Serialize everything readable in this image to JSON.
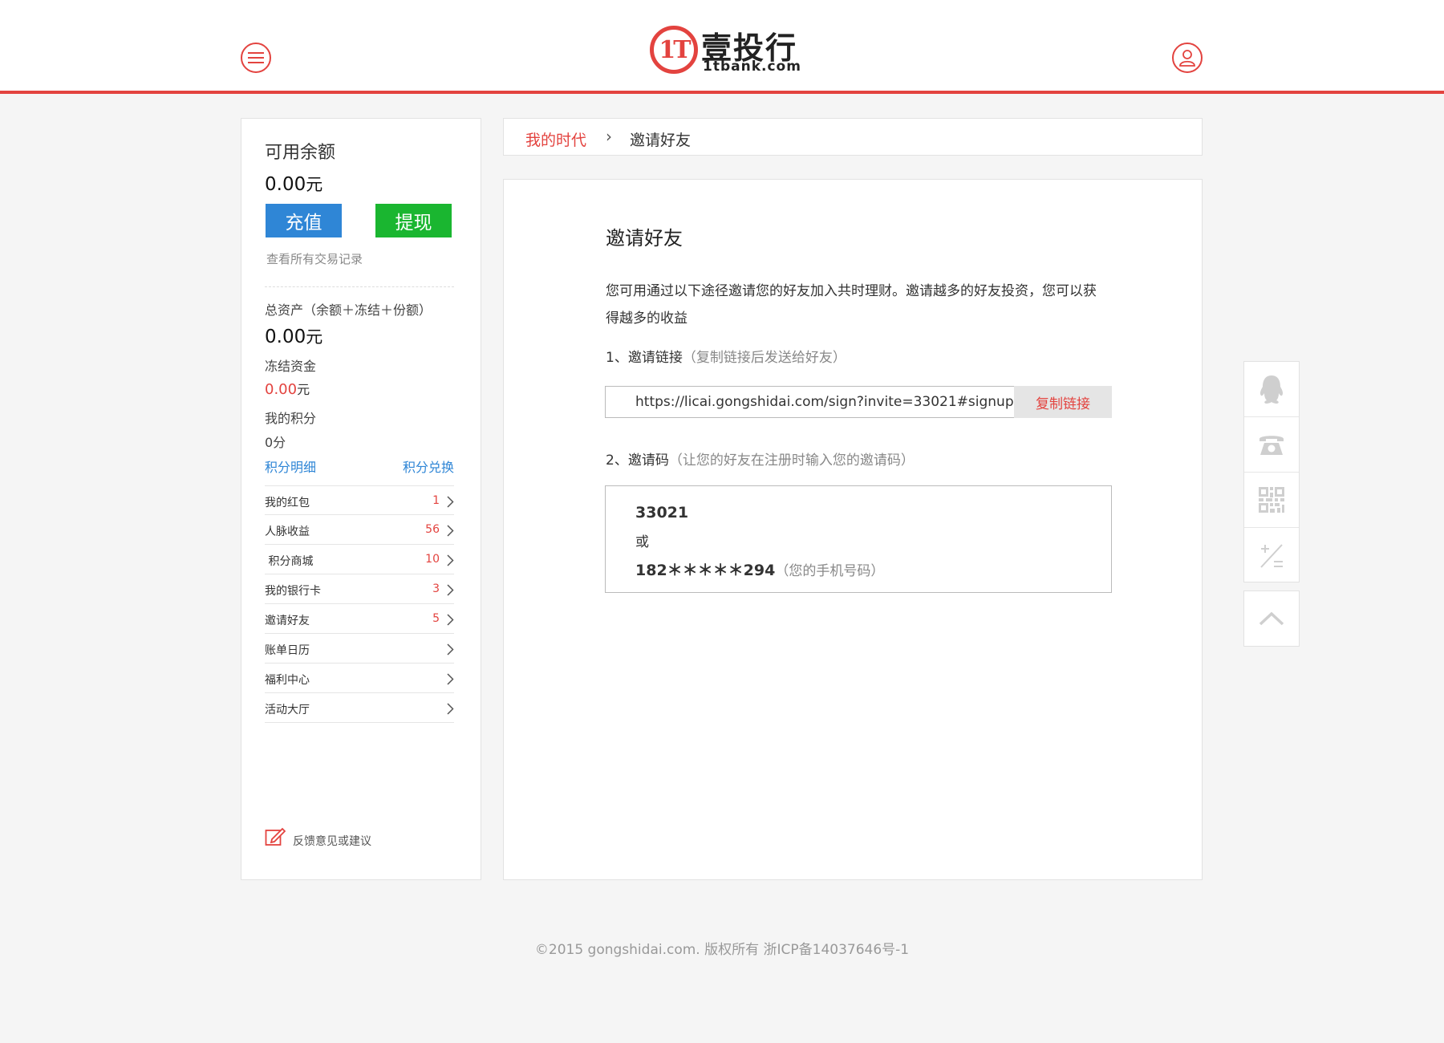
{
  "header": {
    "logo_mark": "1T",
    "logo_cn": "壹投行",
    "logo_en": "1tbank.com"
  },
  "sidebar": {
    "balance_title": "可用余额",
    "balance_value": "0.00",
    "currency_unit": "元",
    "recharge_label": "充值",
    "withdraw_label": "提现",
    "records_link": "查看所有交易记录",
    "total_assets_label": "总资产（余额＋冻结＋份额）",
    "total_assets_value": "0.00",
    "frozen_label": "冻结资金",
    "frozen_value": "0.00",
    "points_label": "我的积分",
    "points_value": "0分",
    "points_detail_link": "积分明细",
    "points_exchange_link": "积分兑换",
    "menu": [
      {
        "label": "我的红包",
        "count": "1"
      },
      {
        "label": "人脉收益",
        "count": "56"
      },
      {
        "label": " 积分商城",
        "count": "10"
      },
      {
        "label": "我的银行卡",
        "count": "3"
      },
      {
        "label": "邀请好友",
        "count": "5"
      },
      {
        "label": "账单日历",
        "count": ""
      },
      {
        "label": "福利中心",
        "count": ""
      },
      {
        "label": "活动大厅",
        "count": ""
      }
    ],
    "feedback_label": "反馈意见或建议"
  },
  "breadcrumb": {
    "home": "我的时代",
    "separator": "›",
    "current": "邀请好友"
  },
  "main": {
    "title": "邀请好友",
    "description": "您可用通过以下途径邀请您的好友加入共时理财。邀请越多的好友投资，您可以获得越多的收益",
    "step1_label": "1、邀请链接",
    "step1_hint": "（复制链接后发送给好友）",
    "invite_link": "https://licai.gongshidai.com/sign?invite=33021#signup",
    "copy_button": "复制链接",
    "step2_label": "2、邀请码",
    "step2_hint": "（让您的好友在注册时输入您的邀请码）",
    "invite_code": "33021",
    "or_text": "或",
    "phone_code": "182＊＊＊＊＊294",
    "phone_hint": "（您的手机号码）"
  },
  "float_bar": {
    "icons": [
      "qq-icon",
      "phone-icon",
      "qrcode-icon",
      "calculator-icon",
      "back-to-top-icon"
    ]
  },
  "footer": {
    "copyright": "©2015 gongshidai.com. 版权所有 浙ICP备14037646号-1"
  },
  "colors": {
    "brand_red": "#e3433f",
    "recharge_blue": "#2f86d6",
    "withdraw_green": "#1ab630"
  }
}
